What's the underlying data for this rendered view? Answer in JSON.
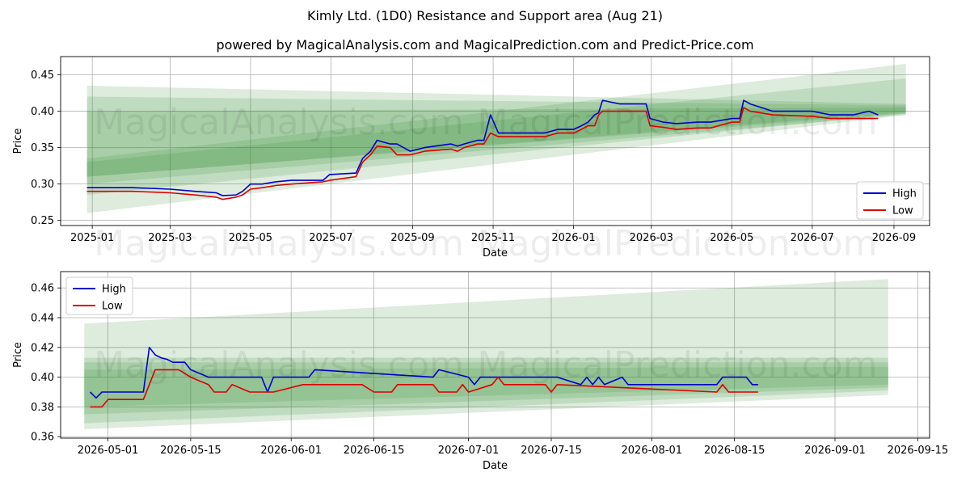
{
  "title": "Kimly Ltd. (1D0) Resistance and Support area (Aug 21)",
  "subtitle": "powered by MagicalAnalysis.com and MagicalPrediction.com and Predict-Price.com",
  "watermarks": [
    "MagicalAnalysis.com",
    "MagicalPrediction.com"
  ],
  "colors": {
    "high": "#0000cc",
    "low": "#dd0000",
    "band": "#2e8b2e",
    "grid": "#b0b0b0"
  },
  "chart_data": [
    {
      "type": "line",
      "xlabel": "Date",
      "ylabel": "Price",
      "xlim": [
        "2024-12-08",
        "2026-09-28"
      ],
      "ylim": [
        0.243,
        0.475
      ],
      "x_ticks": [
        "2025-01",
        "2025-03",
        "2025-05",
        "2025-07",
        "2025-09",
        "2025-11",
        "2026-01",
        "2026-03",
        "2026-05",
        "2026-07",
        "2026-09"
      ],
      "y_ticks": [
        "0.25",
        "0.30",
        "0.35",
        "0.40",
        "0.45"
      ],
      "grid": true,
      "legend": "lower-right",
      "legend_entries": [
        "High",
        "Low"
      ],
      "bands": [
        {
          "x": [
            "2024-12-28",
            "2026-09-10"
          ],
          "upper": [
            0.435,
            0.41
          ],
          "lower": [
            0.26,
            0.395
          ]
        },
        {
          "x": [
            "2024-12-28",
            "2026-09-10"
          ],
          "upper": [
            0.42,
            0.408
          ],
          "lower": [
            0.285,
            0.397
          ]
        },
        {
          "x": [
            "2024-12-28",
            "2026-09-10"
          ],
          "upper": [
            0.4,
            0.405
          ],
          "lower": [
            0.31,
            0.399
          ]
        },
        {
          "x": [
            "2024-12-28",
            "2026-09-10"
          ],
          "upper": [
            0.335,
            0.465
          ],
          "lower": [
            0.3,
            0.395
          ]
        },
        {
          "x": [
            "2024-12-28",
            "2026-09-10"
          ],
          "upper": [
            0.33,
            0.445
          ],
          "lower": [
            0.31,
            0.397
          ]
        }
      ],
      "series": [
        {
          "name": "High",
          "x": [
            "2024-12-28",
            "2025-01-01",
            "2025-02-01",
            "2025-03-01",
            "2025-03-20",
            "2025-04-05",
            "2025-04-10",
            "2025-04-20",
            "2025-04-25",
            "2025-05-01",
            "2025-05-10",
            "2025-05-20",
            "2025-06-01",
            "2025-06-25",
            "2025-06-30",
            "2025-07-20",
            "2025-07-25",
            "2025-07-31",
            "2025-08-05",
            "2025-08-15",
            "2025-08-20",
            "2025-08-30",
            "2025-09-10",
            "2025-09-30",
            "2025-10-05",
            "2025-10-10",
            "2025-10-20",
            "2025-10-25",
            "2025-10-30",
            "2025-11-05",
            "2025-11-15",
            "2025-11-30",
            "2025-12-10",
            "2025-12-20",
            "2026-01-01",
            "2026-01-07",
            "2026-01-12",
            "2026-01-17",
            "2026-01-20",
            "2026-01-23",
            "2026-02-05",
            "2026-02-15",
            "2026-02-25",
            "2026-02-28",
            "2026-03-10",
            "2026-03-20",
            "2026-04-05",
            "2026-04-15",
            "2026-05-01",
            "2026-05-07",
            "2026-05-10",
            "2026-05-15",
            "2026-06-01",
            "2026-07-01",
            "2026-07-15",
            "2026-08-01",
            "2026-08-13",
            "2026-08-20"
          ],
          "values": [
            0.295,
            0.295,
            0.295,
            0.293,
            0.29,
            0.288,
            0.284,
            0.285,
            0.29,
            0.3,
            0.3,
            0.303,
            0.305,
            0.305,
            0.313,
            0.315,
            0.335,
            0.345,
            0.36,
            0.355,
            0.355,
            0.345,
            0.35,
            0.355,
            0.352,
            0.355,
            0.36,
            0.36,
            0.395,
            0.37,
            0.37,
            0.37,
            0.37,
            0.375,
            0.375,
            0.38,
            0.385,
            0.395,
            0.398,
            0.415,
            0.41,
            0.41,
            0.41,
            0.39,
            0.385,
            0.383,
            0.385,
            0.385,
            0.39,
            0.39,
            0.415,
            0.41,
            0.4,
            0.4,
            0.395,
            0.395,
            0.4,
            0.395
          ]
        },
        {
          "name": "Low",
          "x": [
            "2024-12-28",
            "2025-01-01",
            "2025-02-01",
            "2025-03-01",
            "2025-03-20",
            "2025-04-05",
            "2025-04-10",
            "2025-04-20",
            "2025-04-25",
            "2025-05-01",
            "2025-05-10",
            "2025-05-20",
            "2025-06-01",
            "2025-06-25",
            "2025-06-30",
            "2025-07-20",
            "2025-07-25",
            "2025-07-31",
            "2025-08-05",
            "2025-08-15",
            "2025-08-20",
            "2025-08-30",
            "2025-09-10",
            "2025-09-30",
            "2025-10-05",
            "2025-10-10",
            "2025-10-20",
            "2025-10-25",
            "2025-10-30",
            "2025-11-05",
            "2025-11-15",
            "2025-11-30",
            "2025-12-10",
            "2025-12-20",
            "2026-01-01",
            "2026-01-07",
            "2026-01-12",
            "2026-01-17",
            "2026-01-20",
            "2026-01-23",
            "2026-02-05",
            "2026-02-15",
            "2026-02-25",
            "2026-02-28",
            "2026-03-10",
            "2026-03-20",
            "2026-04-05",
            "2026-04-15",
            "2026-05-01",
            "2026-05-07",
            "2026-05-10",
            "2026-05-15",
            "2026-06-01",
            "2026-07-01",
            "2026-07-15",
            "2026-08-01",
            "2026-08-13",
            "2026-08-20"
          ],
          "values": [
            0.29,
            0.29,
            0.29,
            0.288,
            0.285,
            0.282,
            0.279,
            0.282,
            0.285,
            0.293,
            0.295,
            0.298,
            0.3,
            0.303,
            0.305,
            0.31,
            0.33,
            0.34,
            0.352,
            0.35,
            0.34,
            0.34,
            0.345,
            0.348,
            0.345,
            0.35,
            0.355,
            0.355,
            0.37,
            0.365,
            0.365,
            0.365,
            0.365,
            0.37,
            0.37,
            0.375,
            0.38,
            0.38,
            0.395,
            0.4,
            0.4,
            0.4,
            0.4,
            0.38,
            0.378,
            0.375,
            0.377,
            0.377,
            0.385,
            0.385,
            0.405,
            0.4,
            0.395,
            0.393,
            0.39,
            0.39,
            0.39,
            0.39
          ]
        }
      ]
    },
    {
      "type": "line",
      "xlabel": "Date",
      "ylabel": "Price",
      "xlim": [
        "2026-04-23",
        "2026-09-17"
      ],
      "ylim": [
        0.359,
        0.471
      ],
      "x_ticks": [
        "2026-05-01",
        "2026-05-15",
        "2026-06-01",
        "2026-06-15",
        "2026-07-01",
        "2026-07-15",
        "2026-08-01",
        "2026-08-15",
        "2026-09-01",
        "2026-09-15"
      ],
      "y_ticks": [
        "0.36",
        "0.38",
        "0.40",
        "0.42",
        "0.44",
        "0.46"
      ],
      "grid": true,
      "legend": "upper-left",
      "legend_entries": [
        "High",
        "Low"
      ],
      "bands": [
        {
          "x": [
            "2026-04-27",
            "2026-09-10"
          ],
          "upper": [
            0.436,
            0.466
          ],
          "lower": [
            0.365,
            0.388
          ]
        },
        {
          "x": [
            "2026-04-27",
            "2026-09-10"
          ],
          "upper": [
            0.413,
            0.413
          ],
          "lower": [
            0.369,
            0.391
          ]
        },
        {
          "x": [
            "2026-04-27",
            "2026-09-10"
          ],
          "upper": [
            0.41,
            0.41
          ],
          "lower": [
            0.375,
            0.393
          ]
        },
        {
          "x": [
            "2026-04-27",
            "2026-09-10"
          ],
          "upper": [
            0.405,
            0.407
          ],
          "lower": [
            0.38,
            0.395
          ]
        }
      ],
      "series": [
        {
          "name": "High",
          "x": [
            "2026-04-28",
            "2026-04-29",
            "2026-04-30",
            "2026-05-06",
            "2026-05-07",
            "2026-05-08",
            "2026-05-09",
            "2026-05-10",
            "2026-05-11",
            "2026-05-12",
            "2026-05-13",
            "2026-05-14",
            "2026-05-15",
            "2026-05-18",
            "2026-05-27",
            "2026-05-28",
            "2026-05-29",
            "2026-06-04",
            "2026-06-05",
            "2026-06-25",
            "2026-06-26",
            "2026-07-01",
            "2026-07-02",
            "2026-07-03",
            "2026-07-16",
            "2026-07-20",
            "2026-07-21",
            "2026-07-22",
            "2026-07-23",
            "2026-07-24",
            "2026-07-27",
            "2026-07-28",
            "2026-08-12",
            "2026-08-13",
            "2026-08-17",
            "2026-08-18",
            "2026-08-19"
          ],
          "values": [
            0.39,
            0.386,
            0.39,
            0.39,
            0.39,
            0.42,
            0.415,
            0.413,
            0.412,
            0.41,
            0.41,
            0.41,
            0.405,
            0.4,
            0.4,
            0.39,
            0.4,
            0.4,
            0.405,
            0.4,
            0.405,
            0.4,
            0.395,
            0.4,
            0.4,
            0.395,
            0.4,
            0.395,
            0.4,
            0.395,
            0.4,
            0.395,
            0.395,
            0.4,
            0.4,
            0.395,
            0.395
          ]
        },
        {
          "name": "Low",
          "x": [
            "2026-04-28",
            "2026-04-30",
            "2026-05-01",
            "2026-05-07",
            "2026-05-09",
            "2026-05-13",
            "2026-05-15",
            "2026-05-18",
            "2026-05-19",
            "2026-05-21",
            "2026-05-22",
            "2026-05-25",
            "2026-05-29",
            "2026-06-03",
            "2026-06-13",
            "2026-06-15",
            "2026-06-18",
            "2026-06-19",
            "2026-06-25",
            "2026-06-26",
            "2026-06-29",
            "2026-06-30",
            "2026-07-01",
            "2026-07-05",
            "2026-07-06",
            "2026-07-07",
            "2026-07-08",
            "2026-07-14",
            "2026-07-15",
            "2026-07-16",
            "2026-08-12",
            "2026-08-13",
            "2026-08-14",
            "2026-08-19"
          ],
          "values": [
            0.38,
            0.38,
            0.385,
            0.385,
            0.405,
            0.405,
            0.4,
            0.395,
            0.39,
            0.39,
            0.395,
            0.39,
            0.39,
            0.395,
            0.395,
            0.39,
            0.39,
            0.395,
            0.395,
            0.39,
            0.39,
            0.395,
            0.39,
            0.395,
            0.4,
            0.395,
            0.395,
            0.395,
            0.39,
            0.395,
            0.39,
            0.395,
            0.39,
            0.39
          ]
        }
      ]
    }
  ]
}
